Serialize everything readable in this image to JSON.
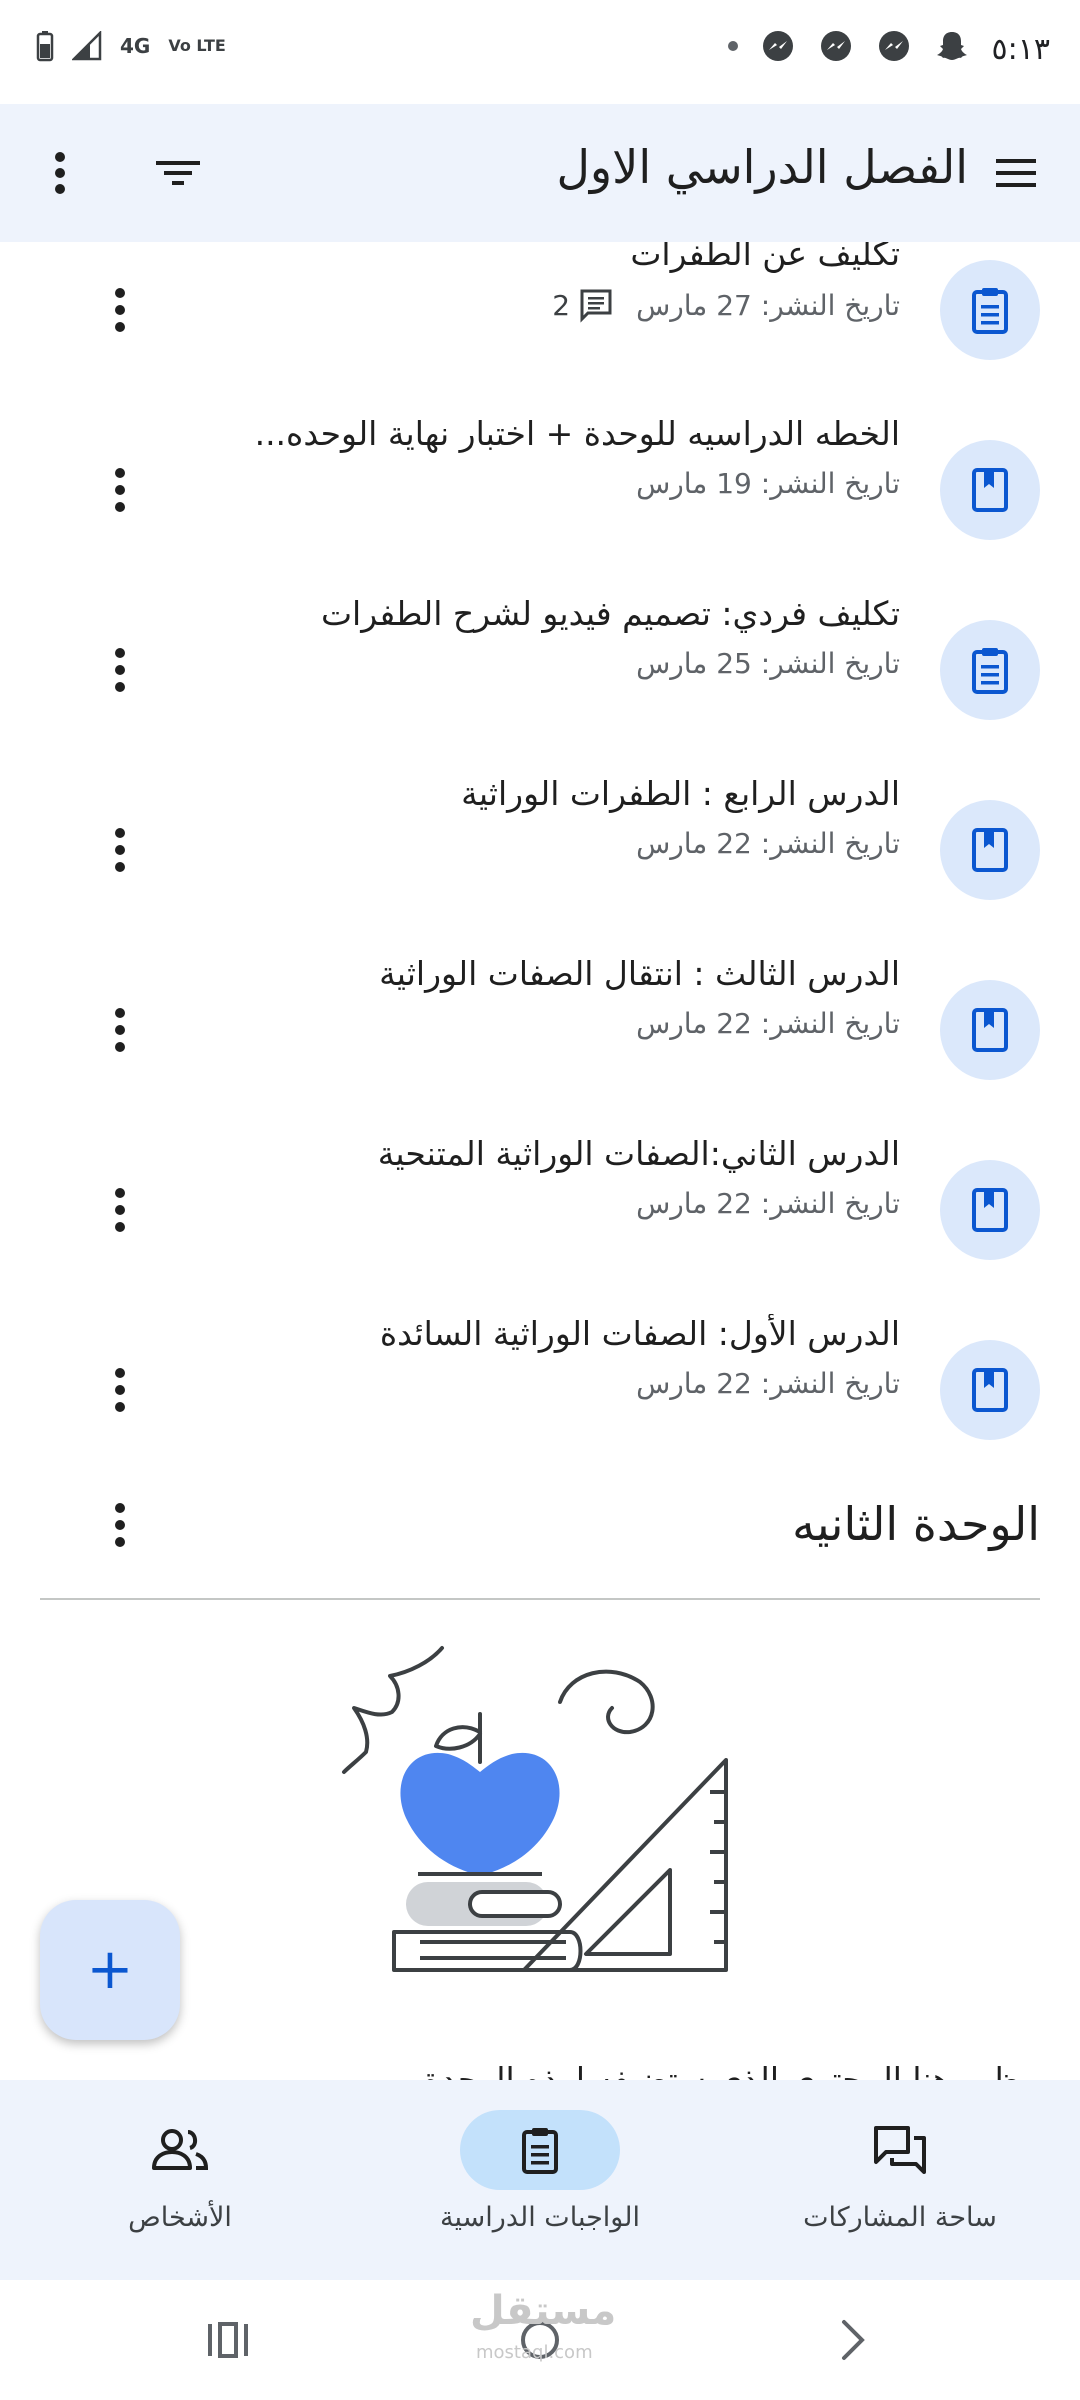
{
  "status_bar": {
    "time": "٥:١٣",
    "network": "4G",
    "volte": "Vo LTE",
    "icons": [
      "battery-icon",
      "signal-icon",
      "messenger-icon",
      "messenger-icon",
      "messenger-icon",
      "snapchat-icon"
    ]
  },
  "app_bar": {
    "title": "الفصل الدراسي الاول",
    "menu_icon": "hamburger-icon",
    "filter_icon": "filter-icon",
    "more_icon": "more-vert-icon"
  },
  "items": [
    {
      "title": "تكليف عن الطفرات",
      "meta": "تاريخ النشر: 27 مارس",
      "comments": "2",
      "type": "assignment"
    },
    {
      "title": "الخطه الدراسيه للوحدة + اختبار نهاية الوحده...",
      "meta": "تاريخ النشر: 19 مارس",
      "type": "material"
    },
    {
      "title": "تكليف فردي: تصميم فيديو لشرح الطفرات",
      "meta": "تاريخ النشر: 25 مارس",
      "type": "assignment"
    },
    {
      "title": "الدرس الرابع : الطفرات الوراثية",
      "meta": "تاريخ النشر: 22 مارس",
      "type": "material"
    },
    {
      "title": "الدرس الثالث : انتقال الصفات الوراثية",
      "meta": "تاريخ النشر: 22 مارس",
      "type": "material"
    },
    {
      "title": "الدرس الثاني:الصفات الوراثية المتنحية",
      "meta": "تاريخ النشر: 22 مارس",
      "type": "material"
    },
    {
      "title": "الدرس الأول: الصفات الوراثية السائدة",
      "meta": "تاريخ النشر: 22 مارس",
      "type": "material"
    }
  ],
  "section": {
    "title": "الوحدة الثانيه"
  },
  "empty_state_text": "ظهر هنا المحتوى الذي ستضيفه لهذه الوحدة",
  "fab": {
    "label": "+"
  },
  "bottom_nav": [
    {
      "label": "ساحة المشاركات",
      "icon": "forum-icon",
      "active": false
    },
    {
      "label": "الواجبات الدراسية",
      "icon": "assignment-icon",
      "active": true
    },
    {
      "label": "الأشخاص",
      "icon": "people-icon",
      "active": false
    }
  ],
  "watermark": {
    "text": "مستقل",
    "sub": "mostaql.com"
  },
  "colors": {
    "accent": "#0b57d0",
    "surface": "#eef3fc",
    "icon_bg": "#dbe8fb",
    "nav_active": "#c3e1fb"
  }
}
